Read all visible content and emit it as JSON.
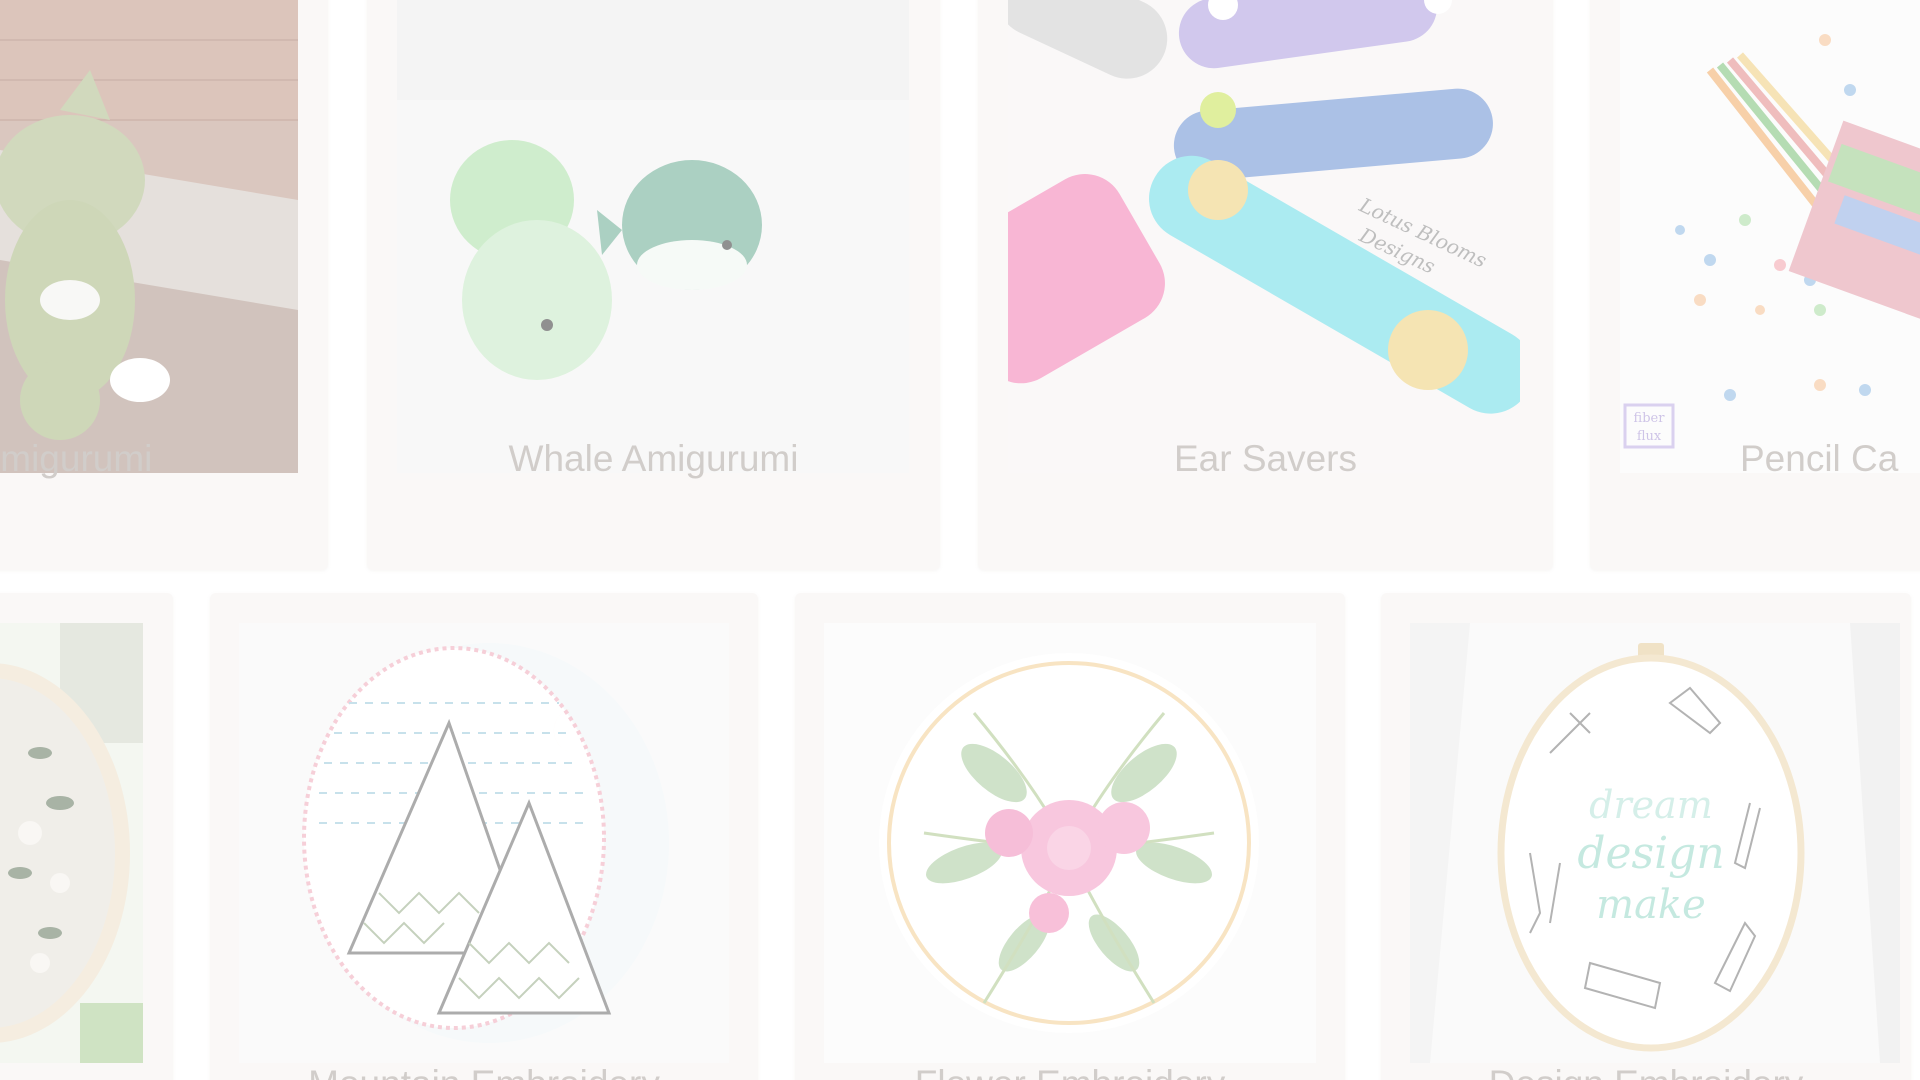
{
  "cards": [
    {
      "title": "Amigurumi",
      "thumb_icon": "cat-amigurumi-photo"
    },
    {
      "title": "Whale Amigurumi",
      "thumb_icon": "whale-amigurumi-photo"
    },
    {
      "title": "Ear Savers",
      "thumb_icon": "ear-savers-photo",
      "watermark": "Lotus Blooms Designs"
    },
    {
      "title": "Pencil Ca",
      "thumb_icon": "pencil-case-photo",
      "logo": "fiber flux"
    },
    {
      "title": "",
      "thumb_icon": "floral-hoop-photo"
    },
    {
      "title": "Mountain Embroidery",
      "thumb_icon": "mountain-embroidery-photo"
    },
    {
      "title": "Flower Embroidery",
      "thumb_icon": "flower-embroidery-photo"
    },
    {
      "title": "Design Embroidery",
      "thumb_icon": "design-embroidery-photo",
      "hoop_text": [
        "dream",
        "design",
        "make"
      ]
    }
  ]
}
